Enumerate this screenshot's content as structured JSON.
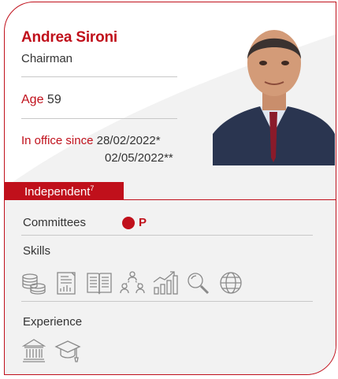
{
  "profile": {
    "name": "Andrea Sironi",
    "role": "Chairman",
    "age_label": "Age",
    "age_value": "59",
    "office_label": "In office since",
    "office_date_1": "28/02/2022*",
    "office_date_2": "02/05/2022**"
  },
  "status": {
    "label": "Independent",
    "footnote": "7"
  },
  "committees": {
    "label": "Committees",
    "value": "P"
  },
  "skills": {
    "label": "Skills",
    "icons": [
      "coins-icon",
      "financial-report-icon",
      "open-book-icon",
      "people-network-icon",
      "bar-chart-growth-icon",
      "magnifier-icon",
      "globe-icon"
    ]
  },
  "experience": {
    "label": "Experience",
    "icons": [
      "institution-building-icon",
      "graduation-cap-icon"
    ]
  },
  "colors": {
    "accent": "#c0101b",
    "text": "#333333",
    "icon": "#8a8a8a"
  }
}
